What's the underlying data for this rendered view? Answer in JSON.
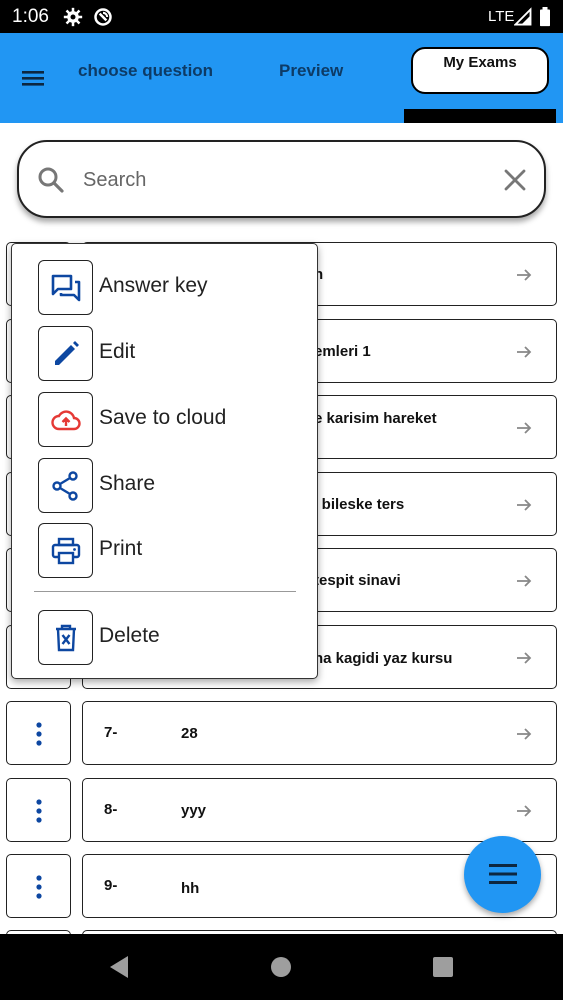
{
  "status_bar": {
    "time": "1:06",
    "network": "LTE",
    "icons": [
      "gear-icon",
      "no-disturb-icon",
      "signal-icon",
      "battery-icon"
    ]
  },
  "app_bar": {
    "tabs": [
      {
        "label": "choose question"
      },
      {
        "label": "Preview"
      }
    ],
    "my_exams_label": "My Exams",
    "color": "#2196f3",
    "tab_text_color": "#0d3b66"
  },
  "search": {
    "placeholder": "Search",
    "value": ""
  },
  "list": {
    "rows": [
      {
        "num": "",
        "title": "n"
      },
      {
        "num": "",
        "title": "emleri 1"
      },
      {
        "num": "",
        "title": "e karisim hareket"
      },
      {
        "num": "",
        "title": "fik bileske ters"
      },
      {
        "num": "",
        "title": "tespit sinavi"
      },
      {
        "num": "",
        "title": "na kagidi yaz kursu"
      },
      {
        "num": "7-",
        "title": "28"
      },
      {
        "num": "8-",
        "title": "yyy"
      },
      {
        "num": "9-",
        "title": "hh"
      }
    ]
  },
  "context_menu": {
    "items": [
      {
        "label": "Answer key",
        "icon": "answer-key-icon",
        "color": "#0d47a1"
      },
      {
        "label": "Edit",
        "icon": "edit-icon",
        "color": "#0d47a1"
      },
      {
        "label": "Save to cloud",
        "icon": "cloud-upload-icon",
        "color": "#e53935"
      },
      {
        "label": "Share",
        "icon": "share-icon",
        "color": "#0d47a1"
      },
      {
        "label": "Print",
        "icon": "print-icon",
        "color": "#0d47a1"
      },
      {
        "label": "Delete",
        "icon": "delete-icon",
        "color": "#0d47a1"
      }
    ]
  },
  "fab": {
    "icon": "menu-icon",
    "color": "#2196f3"
  },
  "nav_bar": {
    "icons": [
      "back-icon",
      "home-icon",
      "recents-icon"
    ]
  }
}
